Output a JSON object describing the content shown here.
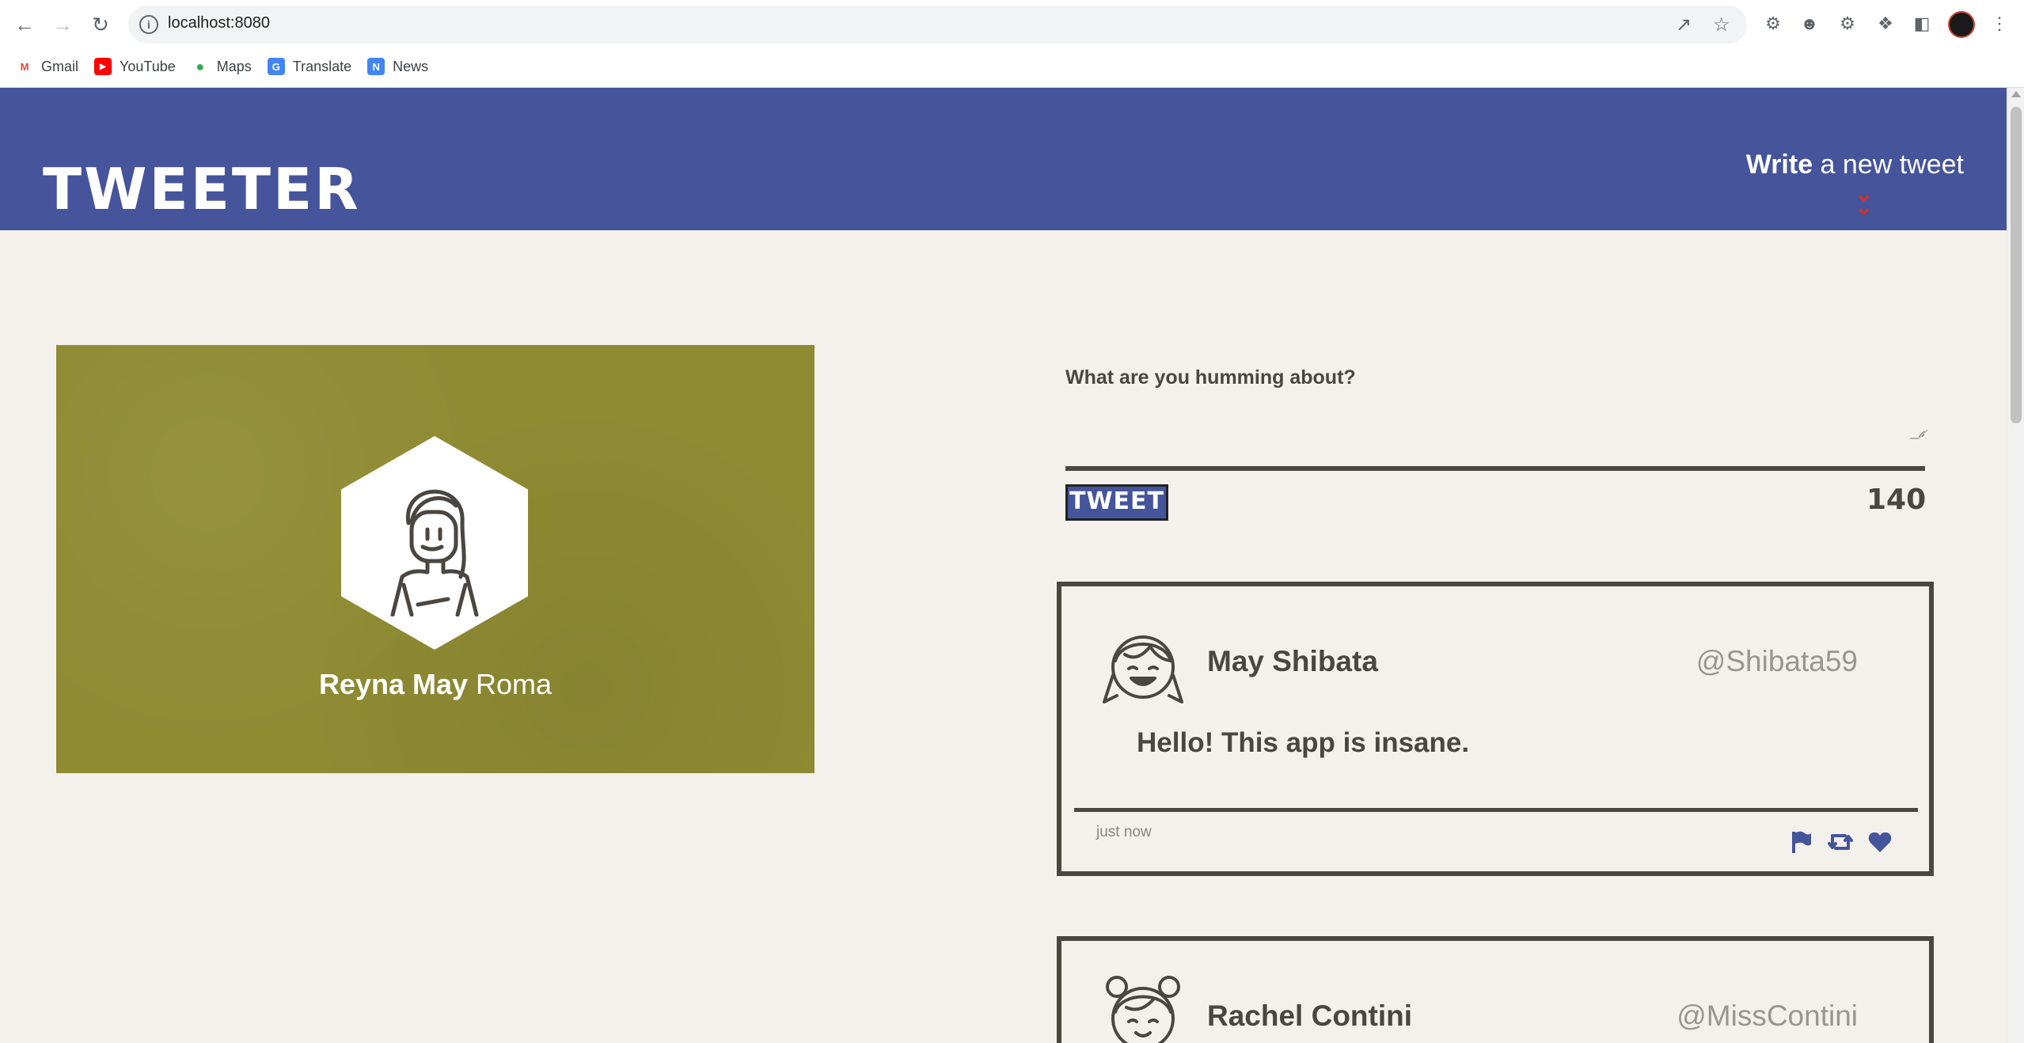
{
  "browser": {
    "url": "localhost:8080",
    "bookmarks": [
      {
        "label": "Gmail",
        "icon": "gmail-icon",
        "color": "#ea4335"
      },
      {
        "label": "YouTube",
        "icon": "youtube-icon",
        "color": "#ff0000"
      },
      {
        "label": "Maps",
        "icon": "maps-icon",
        "color": "#34a853"
      },
      {
        "label": "Translate",
        "icon": "translate-icon",
        "color": "#4285f4"
      },
      {
        "label": "News",
        "icon": "news-icon",
        "color": "#4285f4"
      }
    ]
  },
  "nav": {
    "brand": "TWEETER",
    "compose_bold": "Write",
    "compose_rest": " a new tweet",
    "accent": "#45549b",
    "chevron_color": "#d0312d"
  },
  "profile": {
    "first": "Reyna May",
    "last": " Roma",
    "background": "#8f8b33"
  },
  "new_tweet": {
    "label": "What are you humming about?",
    "value": "",
    "button": "TWEET",
    "counter": "140"
  },
  "tweets": [
    {
      "name": "May Shibata",
      "handle": "@Shibata59",
      "text": "Hello! This app is insane.",
      "time": "just now",
      "actions": [
        "flag-icon",
        "retweet-icon",
        "heart-icon"
      ]
    },
    {
      "name": "Rachel Contini",
      "handle": "@MissContini"
    }
  ]
}
